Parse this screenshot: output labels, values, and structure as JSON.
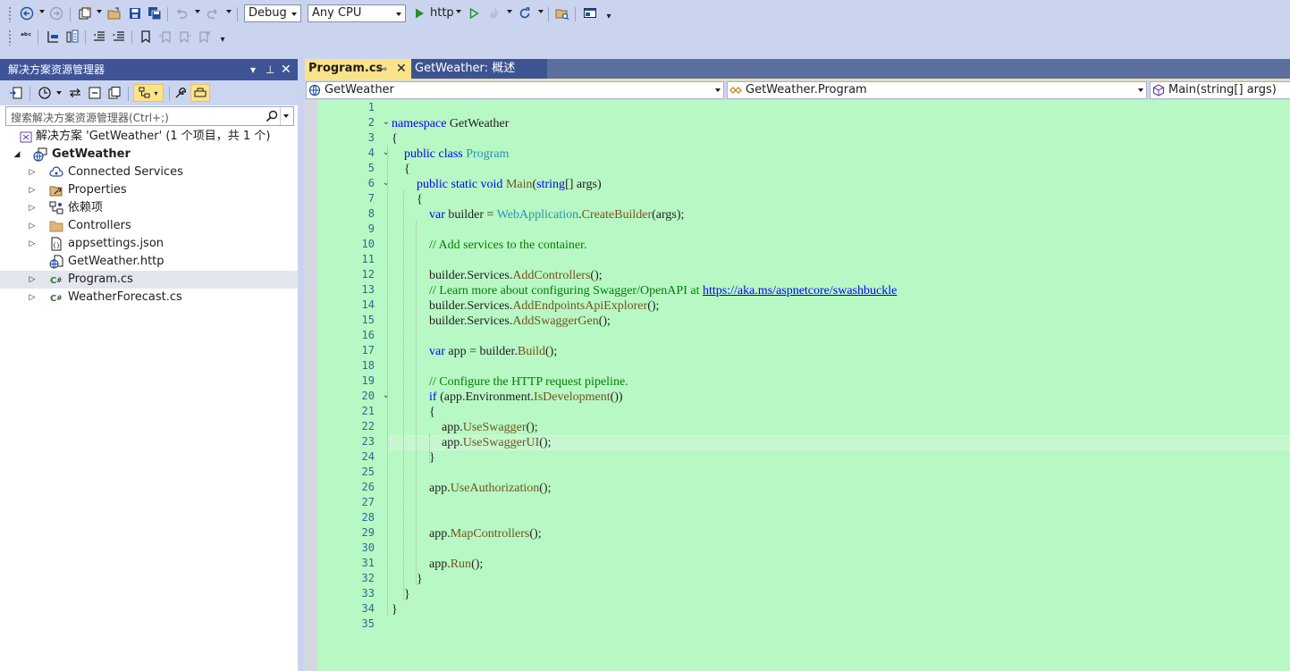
{
  "toolbar": {
    "configuration": "Debug",
    "platform": "Any CPU",
    "run_target": "http"
  },
  "solution_explorer": {
    "title": "解决方案资源管理器",
    "search_placeholder": "搜索解决方案资源管理器(Ctrl+;)",
    "tree": [
      {
        "label": "解决方案 'GetWeather' (1 个项目，共 1 个)",
        "icon": "solution-icon",
        "expander": "",
        "bold": false
      },
      {
        "label": "GetWeather",
        "icon": "web-project-icon",
        "expander": "expanded",
        "bold": true
      },
      {
        "label": "Connected Services",
        "icon": "connected-services-icon",
        "expander": "collapsed",
        "bold": false
      },
      {
        "label": "Properties",
        "icon": "properties-icon",
        "expander": "collapsed",
        "bold": false
      },
      {
        "label": "依赖项",
        "icon": "dependencies-icon",
        "expander": "collapsed",
        "bold": false
      },
      {
        "label": "Controllers",
        "icon": "folder-icon",
        "expander": "collapsed",
        "bold": false
      },
      {
        "label": "appsettings.json",
        "icon": "json-file-icon",
        "expander": "collapsed",
        "bold": false
      },
      {
        "label": "GetWeather.http",
        "icon": "http-file-icon",
        "expander": "",
        "bold": false
      },
      {
        "label": "Program.cs",
        "icon": "csharp-file-icon",
        "expander": "collapsed",
        "bold": false,
        "selected": true
      },
      {
        "label": "WeatherForecast.cs",
        "icon": "csharp-file-icon",
        "expander": "collapsed",
        "bold": false
      }
    ]
  },
  "editor": {
    "tabs": [
      {
        "label": "Program.cs",
        "active": true
      },
      {
        "label": "GetWeather: 概述",
        "active": false
      }
    ],
    "nav": {
      "project": "GetWeather",
      "type": "GetWeather.Program",
      "member": "Main(string[] args)"
    },
    "current_line": 23,
    "lines": [
      {
        "n": "1",
        "fold": "",
        "code": ""
      },
      {
        "n": "2",
        "fold": "v",
        "code": "namespace GetWeather"
      },
      {
        "n": "3",
        "fold": "",
        "code": "{"
      },
      {
        "n": "4",
        "fold": "v",
        "code": "    public class Program"
      },
      {
        "n": "5",
        "fold": "",
        "code": "    {"
      },
      {
        "n": "6",
        "fold": "v",
        "code": "        public static void Main(string[] args)"
      },
      {
        "n": "7",
        "fold": "",
        "code": "        {"
      },
      {
        "n": "8",
        "fold": "",
        "code": "            var builder = WebApplication.CreateBuilder(args);"
      },
      {
        "n": "9",
        "fold": "",
        "code": ""
      },
      {
        "n": "10",
        "fold": "",
        "code": "            // Add services to the container."
      },
      {
        "n": "11",
        "fold": "",
        "code": ""
      },
      {
        "n": "12",
        "fold": "",
        "code": "            builder.Services.AddControllers();"
      },
      {
        "n": "13",
        "fold": "",
        "code": "            // Learn more about configuring Swagger/OpenAPI at https://aka.ms/aspnetcore/swashbuckle"
      },
      {
        "n": "14",
        "fold": "",
        "code": "            builder.Services.AddEndpointsApiExplorer();"
      },
      {
        "n": "15",
        "fold": "",
        "code": "            builder.Services.AddSwaggerGen();"
      },
      {
        "n": "16",
        "fold": "",
        "code": ""
      },
      {
        "n": "17",
        "fold": "",
        "code": "            var app = builder.Build();"
      },
      {
        "n": "18",
        "fold": "",
        "code": ""
      },
      {
        "n": "19",
        "fold": "",
        "code": "            // Configure the HTTP request pipeline."
      },
      {
        "n": "20",
        "fold": "v",
        "code": "            if (app.Environment.IsDevelopment())"
      },
      {
        "n": "21",
        "fold": "",
        "code": "            {"
      },
      {
        "n": "22",
        "fold": "",
        "code": "                app.UseSwagger();"
      },
      {
        "n": "23",
        "fold": "",
        "code": "                app.UseSwaggerUI();"
      },
      {
        "n": "24",
        "fold": "",
        "code": "            }"
      },
      {
        "n": "25",
        "fold": "",
        "code": ""
      },
      {
        "n": "26",
        "fold": "",
        "code": "            app.UseAuthorization();"
      },
      {
        "n": "27",
        "fold": "",
        "code": ""
      },
      {
        "n": "28",
        "fold": "",
        "code": ""
      },
      {
        "n": "29",
        "fold": "",
        "code": "            app.MapControllers();"
      },
      {
        "n": "30",
        "fold": "",
        "code": ""
      },
      {
        "n": "31",
        "fold": "",
        "code": "            app.Run();"
      },
      {
        "n": "32",
        "fold": "",
        "code": "        }"
      },
      {
        "n": "33",
        "fold": "",
        "code": "    }"
      },
      {
        "n": "34",
        "fold": "",
        "code": "}"
      },
      {
        "n": "35",
        "fold": "",
        "code": ""
      }
    ]
  }
}
